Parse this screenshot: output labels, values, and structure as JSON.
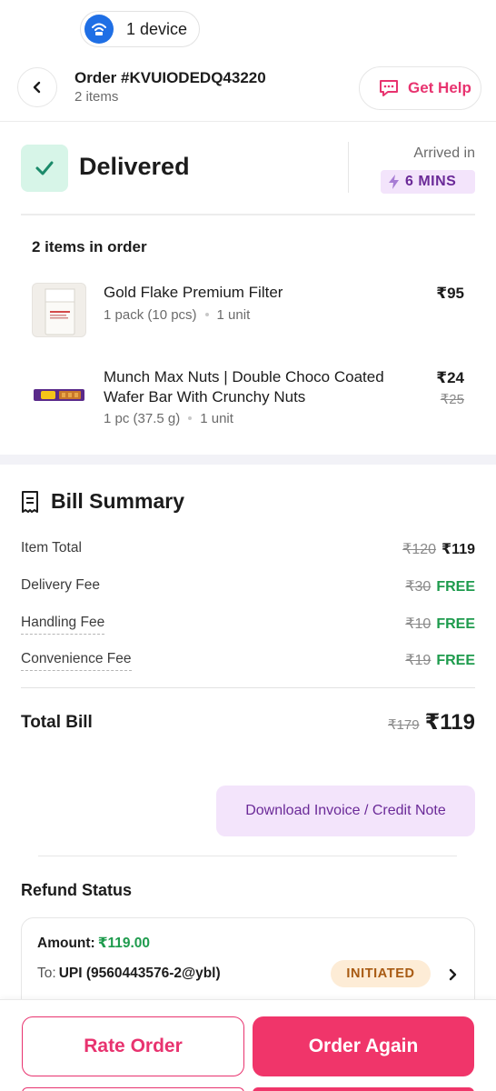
{
  "device": {
    "label": "1 device",
    "icon": "wifi-icon"
  },
  "header": {
    "order_id": "Order #KVUIODEDQ43220",
    "items_count": "2 items",
    "help_label": "Get Help"
  },
  "status": {
    "title": "Delivered",
    "arrived_label": "Arrived in",
    "arrived_time": "6 MINS"
  },
  "items_section": {
    "title": "2 items in order",
    "items": [
      {
        "name": "Gold Flake Premium Filter",
        "qty": "1 pack (10 pcs)",
        "units": "1 unit",
        "price": "₹95",
        "mrp": ""
      },
      {
        "name": "Munch Max Nuts | Double Choco Coated Wafer Bar With Crunchy Nuts",
        "qty": "1 pc (37.5 g)",
        "units": "1 unit",
        "price": "₹24",
        "mrp": "₹25"
      }
    ]
  },
  "bill": {
    "title": "Bill Summary",
    "rows": [
      {
        "label": "Item Total",
        "old": "₹120",
        "new": "₹119"
      },
      {
        "label": "Delivery Fee",
        "old": "₹30",
        "new": "FREE"
      },
      {
        "label": "Handling Fee",
        "old": "₹10",
        "new": "FREE"
      },
      {
        "label": "Convenience Fee",
        "old": "₹19",
        "new": "FREE"
      }
    ],
    "total_label": "Total Bill",
    "total_old": "₹179",
    "total_new": "₹119",
    "invoice_label": "Download Invoice / Credit Note"
  },
  "refund": {
    "title": "Refund Status",
    "amount_key": "Amount:",
    "amount_value": "₹119.00",
    "to_key": "To:",
    "to_value": "UPI (9560443576-2@ybl)",
    "status": "INITIATED"
  },
  "actions": {
    "rate_label": "Rate Order",
    "again_label": "Order Again"
  },
  "colors": {
    "brand_pink": "#f0356a",
    "free_green": "#1e9b4d",
    "purple": "#6b2a98",
    "wifi_blue": "#1f6fe5"
  }
}
